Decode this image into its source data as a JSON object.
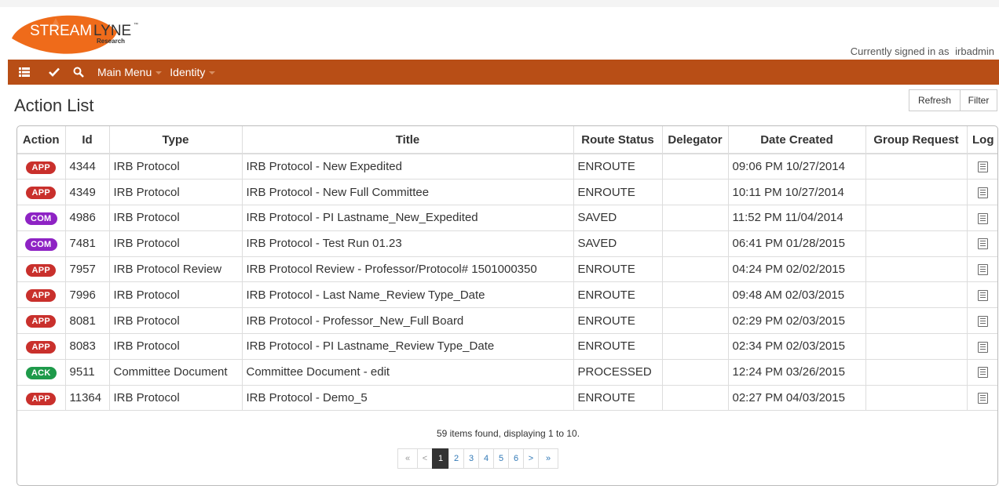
{
  "header": {
    "brand_left": "STREAM",
    "brand_right": "LYNE",
    "brand_tm": "™",
    "brand_sub": "Research",
    "signed_in_text": "Currently signed in as",
    "username": "irbadmin"
  },
  "navbar": {
    "main_menu_label": "Main Menu",
    "identity_label": "Identity"
  },
  "page": {
    "title": "Action List",
    "refresh_label": "Refresh",
    "filter_label": "Filter"
  },
  "table": {
    "columns": [
      "Action",
      "Id",
      "Type",
      "Title",
      "Route Status",
      "Delegator",
      "Date Created",
      "Group Request",
      "Log"
    ],
    "rows": [
      {
        "action": "APP",
        "id": "4344",
        "type": "IRB Protocol",
        "title": "IRB Protocol - New Expedited",
        "status": "ENROUTE",
        "delegator": "",
        "date": "09:06 PM 10/27/2014",
        "group": ""
      },
      {
        "action": "APP",
        "id": "4349",
        "type": "IRB Protocol",
        "title": "IRB Protocol - New Full Committee",
        "status": "ENROUTE",
        "delegator": "",
        "date": "10:11 PM 10/27/2014",
        "group": ""
      },
      {
        "action": "COM",
        "id": "4986",
        "type": "IRB Protocol",
        "title": "IRB Protocol - PI Lastname_New_Expedited",
        "status": "SAVED",
        "delegator": "",
        "date": "11:52 PM 11/04/2014",
        "group": ""
      },
      {
        "action": "COM",
        "id": "7481",
        "type": "IRB Protocol",
        "title": "IRB Protocol - Test Run 01.23",
        "status": "SAVED",
        "delegator": "",
        "date": "06:41 PM 01/28/2015",
        "group": ""
      },
      {
        "action": "APP",
        "id": "7957",
        "type": "IRB Protocol Review",
        "title": "IRB Protocol Review - Professor/Protocol# 1501000350",
        "status": "ENROUTE",
        "delegator": "",
        "date": "04:24 PM 02/02/2015",
        "group": ""
      },
      {
        "action": "APP",
        "id": "7996",
        "type": "IRB Protocol",
        "title": "IRB Protocol - Last Name_Review Type_Date",
        "status": "ENROUTE",
        "delegator": "",
        "date": "09:48 AM 02/03/2015",
        "group": ""
      },
      {
        "action": "APP",
        "id": "8081",
        "type": "IRB Protocol",
        "title": "IRB Protocol - Professor_New_Full Board",
        "status": "ENROUTE",
        "delegator": "",
        "date": "02:29 PM 02/03/2015",
        "group": ""
      },
      {
        "action": "APP",
        "id": "8083",
        "type": "IRB Protocol",
        "title": "IRB Protocol - PI Lastname_Review Type_Date",
        "status": "ENROUTE",
        "delegator": "",
        "date": "02:34 PM 02/03/2015",
        "group": ""
      },
      {
        "action": "ACK",
        "id": "9511",
        "type": "Committee Document",
        "title": "Committee Document - edit",
        "status": "PROCESSED",
        "delegator": "",
        "date": "12:24 PM 03/26/2015",
        "group": ""
      },
      {
        "action": "APP",
        "id": "11364",
        "type": "IRB Protocol",
        "title": "IRB Protocol - Demo_5",
        "status": "ENROUTE",
        "delegator": "",
        "date": "02:27 PM 04/03/2015",
        "group": ""
      }
    ],
    "summary": "59 items found, displaying 1 to 10."
  },
  "badge_colors": {
    "APP": "#c9302c",
    "COM": "#8e23c4",
    "ACK": "#1e9a4a"
  },
  "pagination": {
    "first": "«",
    "prev": "<",
    "pages": [
      "1",
      "2",
      "3",
      "4",
      "5",
      "6"
    ],
    "current": "1",
    "next": ">",
    "last": "»"
  }
}
